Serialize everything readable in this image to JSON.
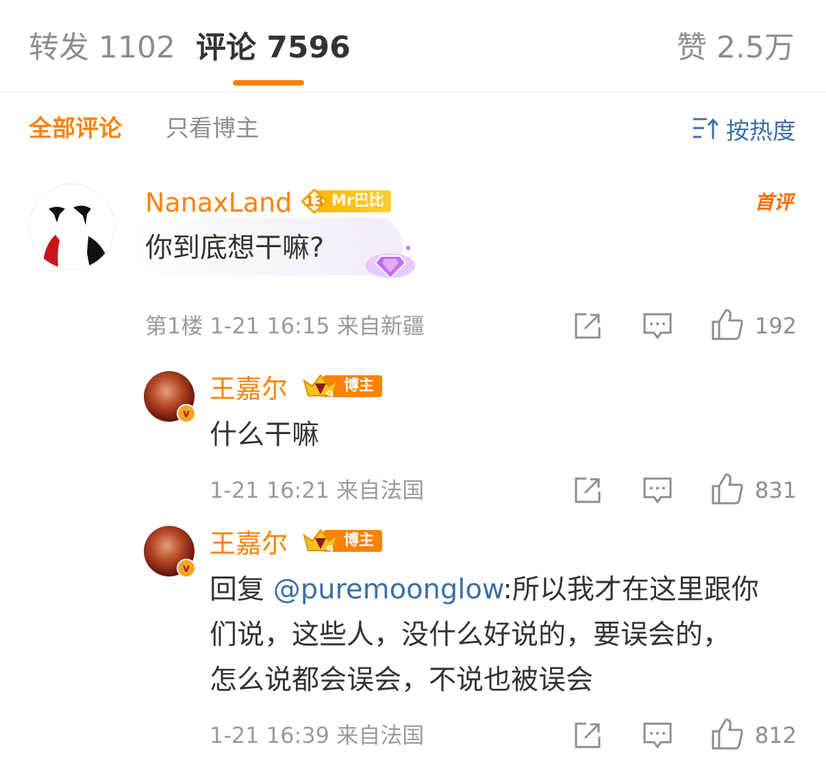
{
  "tabs": {
    "repost": "转发 1102",
    "comment": "评论 7596",
    "like": "赞 2.5万"
  },
  "filters": {
    "all": "全部评论",
    "blogger_only": "只看博主",
    "sort": "按热度"
  },
  "colors": {
    "accent": "#ff8200",
    "link": "#3c6fa6",
    "text": "#333333",
    "muted": "#9a9a9a"
  },
  "comments": [
    {
      "username": "NanaxLand",
      "level": "13",
      "badge": "Mr巴比",
      "first_mark": "首评",
      "text": "你到底想干嘛?",
      "meta": "第1楼 1-21 16:15 来自新疆",
      "likes": "192"
    }
  ],
  "replies": [
    {
      "username": "王嘉尔",
      "badge": "博主",
      "crown_level": "9",
      "text": "什么干嘛",
      "meta": "1-21 16:21 来自法国",
      "likes": "831"
    },
    {
      "username": "王嘉尔",
      "badge": "博主",
      "crown_level": "9",
      "reply_prefix": "回复 ",
      "mention": "@puremoonglow",
      "line1": ":所以我才在这里跟你",
      "line2": "们说，这些人，没什么好说的，要误会的，",
      "line3": "怎么说都会误会，不说也被误会",
      "meta": "1-21 16:39 来自法国",
      "likes": "812"
    }
  ],
  "icons": [
    "sort-icon",
    "share-icon",
    "comment-icon",
    "like-icon",
    "diamond-sticker-icon",
    "crown-icon",
    "verified-icon"
  ]
}
